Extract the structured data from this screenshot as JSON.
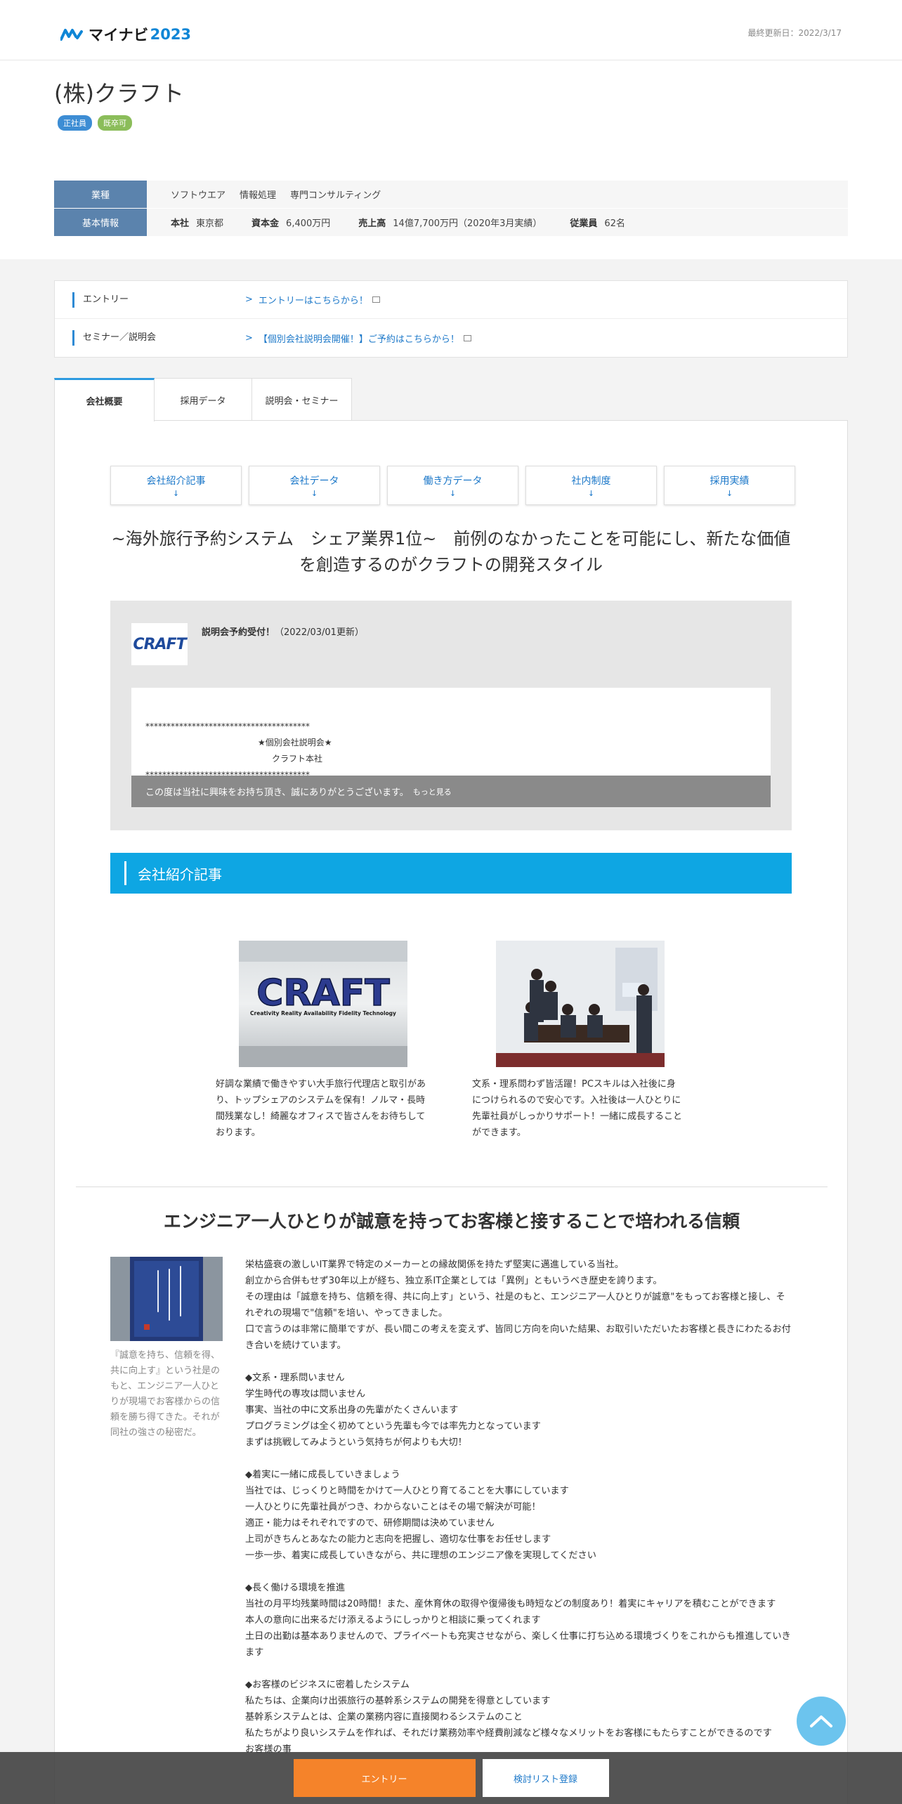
{
  "header": {
    "logo_text": "マイナビ",
    "logo_year": "2023",
    "updated": "最終更新日：2022/3/17"
  },
  "company": {
    "name": "(株)クラフト",
    "tags": [
      "正社員",
      "既卒可"
    ],
    "info": {
      "industry_label": "業種",
      "industry": [
        "ソフトウエア",
        "情報処理",
        "専門コンサルティング"
      ],
      "basic_label": "基本情報",
      "hq_label": "本社",
      "hq": "東京都",
      "capital_label": "資本金",
      "capital": "6,400万円",
      "sales_label": "売上高",
      "sales": "14億7,700万円（2020年3月実績）",
      "employees_label": "従業員",
      "employees": "62名"
    }
  },
  "links": {
    "entry_label": "エントリー",
    "entry_text": "エントリーはこちらから！",
    "seminar_label": "セミナー／説明会",
    "seminar_text": "【個別会社説明会開催！】ご予約はこちらから！"
  },
  "tabs": [
    "会社概要",
    "採用データ",
    "説明会・セミナー"
  ],
  "anchors": [
    "会社紹介記事",
    "会社データ",
    "働き方データ",
    "社内制度",
    "採用実績"
  ],
  "catch": "~海外旅行予約システム　シェア業界1位~　前例のなかったことを可能にし、新たな価値を創造するのがクラフトの開発スタイル",
  "seminar": {
    "logo": "CRAFT",
    "title": "説明会予約受付！",
    "updated": "（2022/03/01更新）",
    "stars1": "***************************************",
    "line1": "★個別会社説明会★",
    "line2": "クラフト本社",
    "stars2": "***************************************",
    "overlay": "この度は当社に興味をお持ち頂き、誠にありがとうございます。",
    "more": "もっと見る"
  },
  "section_title": "会社紹介記事",
  "photos": {
    "craft_sign": "CRAFT",
    "craft_tagline": "Creativity Reality Availability Fidelity Technology",
    "caption1": "好調な業績で働きやすい大手旅行代理店と取引があり、トップシェアのシステムを保有！ノルマ・長時間残業なし！綺麗なオフィスで皆さんをお待ちしております。",
    "caption2": "文系・理系問わず皆活躍！PCスキルは入社後に身につけられるので安心です。入社後は一人ひとりに先輩社員がしっかりサポート！一緒に成長することができます。"
  },
  "sub_heading": "エンジニア一人ひとりが誠意を持ってお客様と接することで培われる信頼",
  "side_caption": "『誠意を持ち、信頼を得、共に向上す』という社是のもと、エンジニア一人ひとりが現場でお客様からの信頼を勝ち得てきた。それが同社の強さの秘密だ。",
  "body": [
    "栄枯盛衰の激しいIT業界で特定のメーカーとの縁故関係を持たず堅実に邁進している当社。",
    "創立から合併もせず30年以上が経ち、独立系IT企業としては「異例」ともいうべき歴史を誇ります。",
    "その理由は「誠意を持ち、信頼を得、共に向上す」という、社是のもと、エンジニア一人ひとりが誠意\"をもってお客様と接し、それぞれの現場で\"信頼\"を培い、やってきました。",
    "口で言うのは非常に簡単ですが、長い間この考えを変えず、皆同じ方向を向いた結果、お取引いただいたお客様と長きにわたるお付き合いを続けています。",
    "",
    "◆文系・理系問いません",
    "学生時代の専攻は問いません",
    "事実、当社の中に文系出身の先輩がたくさんいます",
    "プログラミングは全く初めてという先輩も今では率先力となっています",
    "まずは挑戦してみようという気持ちが何よりも大切！",
    "",
    "◆着実に一緒に成長していきましょう",
    "当社では、じっくりと時間をかけて一人ひとり育てることを大事にしています",
    "一人ひとりに先輩社員がつき、わからないことはその場で解決が可能！",
    "適正・能力はそれぞれですので、研修期間は決めていません",
    "上司がきちんとあなたの能力と志向を把握し、適切な仕事をお任せします",
    "一歩一歩、着実に成長していきながら、共に理想のエンジニア像を実現してください",
    "",
    "◆長く働ける環境を推進",
    "当社の月平均残業時間は20時間！また、産休育休の取得や復帰後も時短などの制度あり！着実にキャリアを積むことができます",
    "本人の意向に出来るだけ添えるようにしっかりと相談に乗ってくれます",
    "土日の出勤は基本ありませんので、プライベートも充実させながら、楽しく仕事に打ち込める環境づくりをこれからも推進していきます",
    "",
    "◆お客様のビジネスに密着したシステム",
    "私たちは、企業向け出張旅行の基幹系システムの開発を得意としています",
    "基幹系システムとは、企業の業務内容に直接関わるシステムのこと",
    "私たちがより良いシステムを作れば、それだけ業務効率や経費削減など様々なメリットをお客様にもたらすことができるのです",
    "お客様の事"
  ],
  "bottom": {
    "entry": "エントリー",
    "list": "検討リスト登録"
  }
}
